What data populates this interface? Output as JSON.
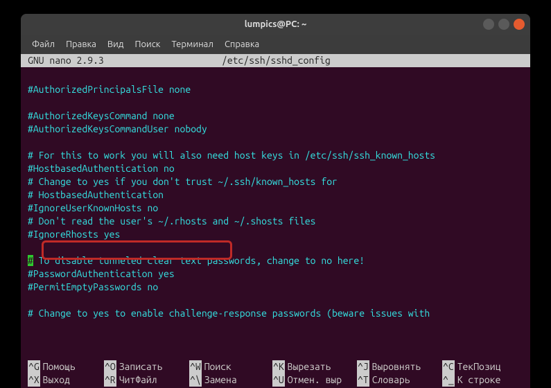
{
  "titlebar": {
    "title": "lumpics@PC: ~"
  },
  "menu": {
    "file": "Файл",
    "edit": "Правка",
    "view": "Вид",
    "search": "Поиск",
    "terminal": "Терминал",
    "help": "Справка"
  },
  "nano_header": {
    "version": "  GNU nano 2.9.3",
    "file": "/etc/ssh/sshd_config"
  },
  "config": {
    "l01": "",
    "l02": "#AuthorizedPrincipalsFile none",
    "l03": "",
    "l04": "#AuthorizedKeysCommand none",
    "l05": "#AuthorizedKeysCommandUser nobody",
    "l06": "",
    "l07": "# For this to work you will also need host keys in /etc/ssh/ssh_known_hosts",
    "l08": "#HostbasedAuthentication no",
    "l09": "# Change to yes if you don't trust ~/.ssh/known_hosts for",
    "l10": "# HostbasedAuthentication",
    "l11": "#IgnoreUserKnownHosts no",
    "l12": "# Don't read the user's ~/.rhosts and ~/.shosts files",
    "l13": "#IgnoreRhosts yes",
    "l14": "",
    "l15_cursor": "#",
    "l15_rest": " To disable tunneled clear text passwords, change to no here!",
    "l16": "#PasswordAuthentication yes",
    "l17": "#PermitEmptyPasswords no",
    "l18": "",
    "l19": "# Change to yes to enable challenge-response passwords (beware issues with"
  },
  "shortcuts": {
    "row1": [
      {
        "key": "^G",
        "label": "Помощь"
      },
      {
        "key": "^O",
        "label": "Записать"
      },
      {
        "key": "^W",
        "label": "Поиск"
      },
      {
        "key": "^K",
        "label": "Вырезать"
      },
      {
        "key": "^J",
        "label": "Выровнять"
      },
      {
        "key": "^C",
        "label": "ТекПозиц"
      }
    ],
    "row2": [
      {
        "key": "^X",
        "label": "Выход"
      },
      {
        "key": "^R",
        "label": "ЧитФайл"
      },
      {
        "key": "^\\",
        "label": "Замена"
      },
      {
        "key": "^U",
        "label": "Отмен. выр"
      },
      {
        "key": "^T",
        "label": "Словарь"
      },
      {
        "key": "^_",
        "label": "К строке"
      }
    ]
  }
}
